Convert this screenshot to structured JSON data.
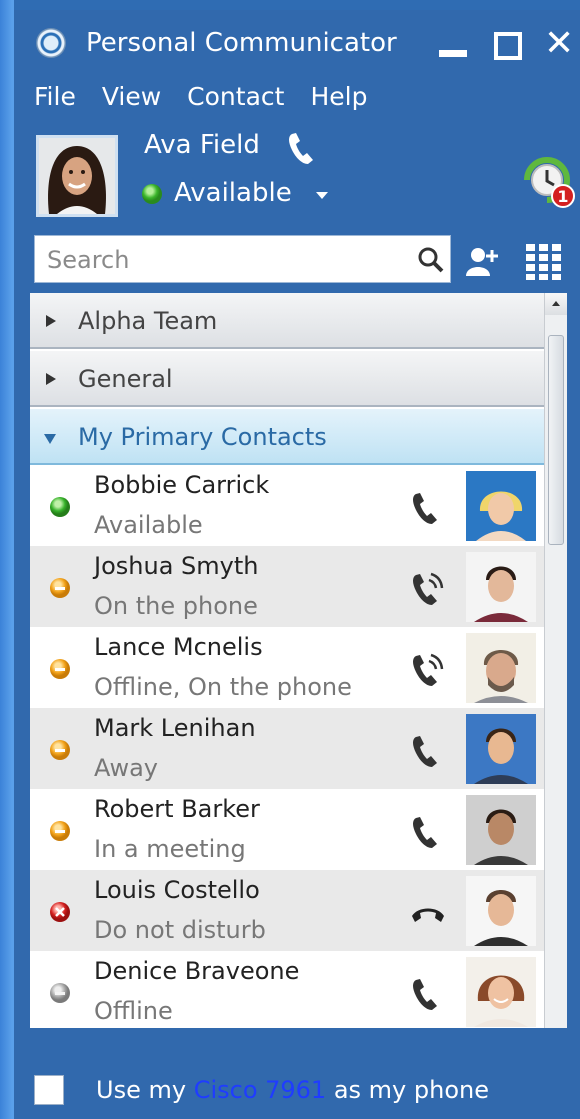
{
  "window": {
    "title": "Personal Communicator",
    "controls": [
      "minimize-icon",
      "maximize-icon",
      "close-icon"
    ],
    "close_glyph": "✕"
  },
  "menu": [
    "File",
    "View",
    "Contact",
    "Help"
  ],
  "user": {
    "name": "Ava Field",
    "status": "Available",
    "status_color": "#3bb52a",
    "reminder_count": "1"
  },
  "search": {
    "placeholder": "Search",
    "value": ""
  },
  "groups": [
    {
      "name": "Alpha Team",
      "expanded": false
    },
    {
      "name": "General",
      "expanded": false
    },
    {
      "name": "My Primary Contacts",
      "expanded": true
    }
  ],
  "contacts": [
    {
      "name": "Bobbie Carrick",
      "status": "Available",
      "presence_color": "#36b12a",
      "phone_icon": "phone-icon"
    },
    {
      "name": "Joshua Smyth",
      "status": "On the phone",
      "presence_color": "#f2a21a",
      "phone_icon": "phone-ringing-icon"
    },
    {
      "name": "Lance Mcnelis",
      "status": "Offline, On the phone",
      "presence_color": "#f2a21a",
      "phone_icon": "phone-ringing-icon"
    },
    {
      "name": "Mark Lenihan",
      "status": "Away",
      "presence_color": "#f2a21a",
      "phone_icon": "phone-icon"
    },
    {
      "name": "Robert Barker",
      "status": "In a meeting",
      "presence_color": "#f2a21a",
      "phone_icon": "phone-icon"
    },
    {
      "name": "Louis Costello",
      "status": "Do not disturb",
      "presence_color": "#d42020",
      "phone_icon": "phone-hangup-icon"
    },
    {
      "name": "Denice Braveone",
      "status": "Offline",
      "presence_color": "#a6a6a6",
      "phone_icon": "phone-icon"
    }
  ],
  "footer": {
    "prefix": "Use my ",
    "device": "Cisco 7961",
    "suffix": " as my phone",
    "checked": false
  },
  "colors": {
    "window_bg": "#3169ad",
    "link": "#1f3cff",
    "expanded_group": "#2a6aa5"
  }
}
